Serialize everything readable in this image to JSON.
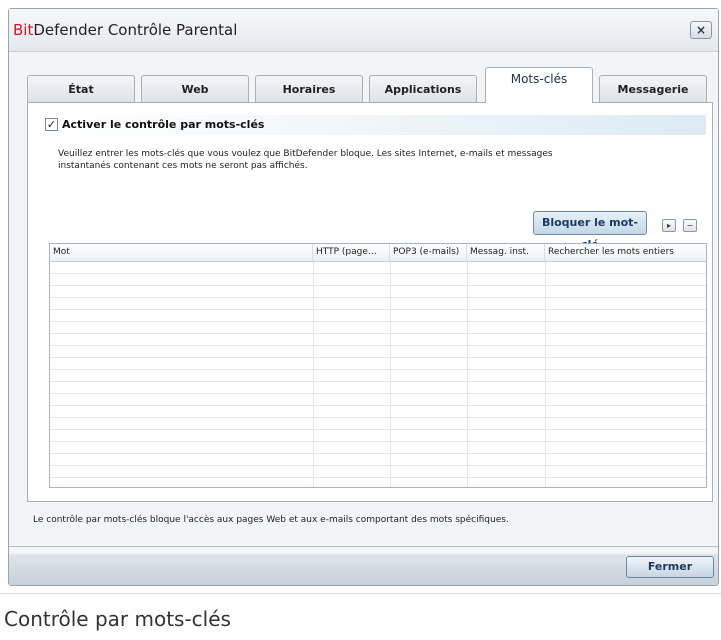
{
  "window": {
    "title_brand": "Bit",
    "title_rest": "Defender Contrôle Parental",
    "close_glyph": "×"
  },
  "tabs": [
    {
      "label": "État",
      "active": false
    },
    {
      "label": "Web",
      "active": false
    },
    {
      "label": "Horaires",
      "active": false
    },
    {
      "label": "Applications",
      "active": false
    },
    {
      "label": "Mots-clés",
      "active": true
    },
    {
      "label": "Messagerie",
      "active": false
    }
  ],
  "panel": {
    "checkbox_checked": true,
    "checkbox_label": "Activer le contrôle par mots-clés",
    "description_line1": "Veuillez entrer les mots-clés que vous voulez que BitDefender bloque. Les sites Internet, e-mails et messages",
    "description_line2": "instantanés contenant ces mots ne seront pas affichés.",
    "block_button": "Bloquer le mot-clé",
    "play_glyph": "▸",
    "minus_glyph": "−"
  },
  "table": {
    "columns": [
      "Mot",
      "HTTP (page…",
      "POP3 (e-mails)",
      "Messag. inst.",
      "Rechercher les mots entiers"
    ],
    "rows": []
  },
  "footer": {
    "info_text": "Le contrôle par mots-clés bloque l'accès aux pages Web et aux e-mails comportant des mots spécifiques.",
    "close_button": "Fermer"
  },
  "caption": "Contrôle par mots-clés",
  "colors": {
    "brand_red": "#d2161e",
    "accent_blue": "#1b3b63",
    "highlight": "#dceaf3"
  },
  "icons": [
    "close-icon",
    "check-icon",
    "play-icon",
    "minus-icon"
  ]
}
